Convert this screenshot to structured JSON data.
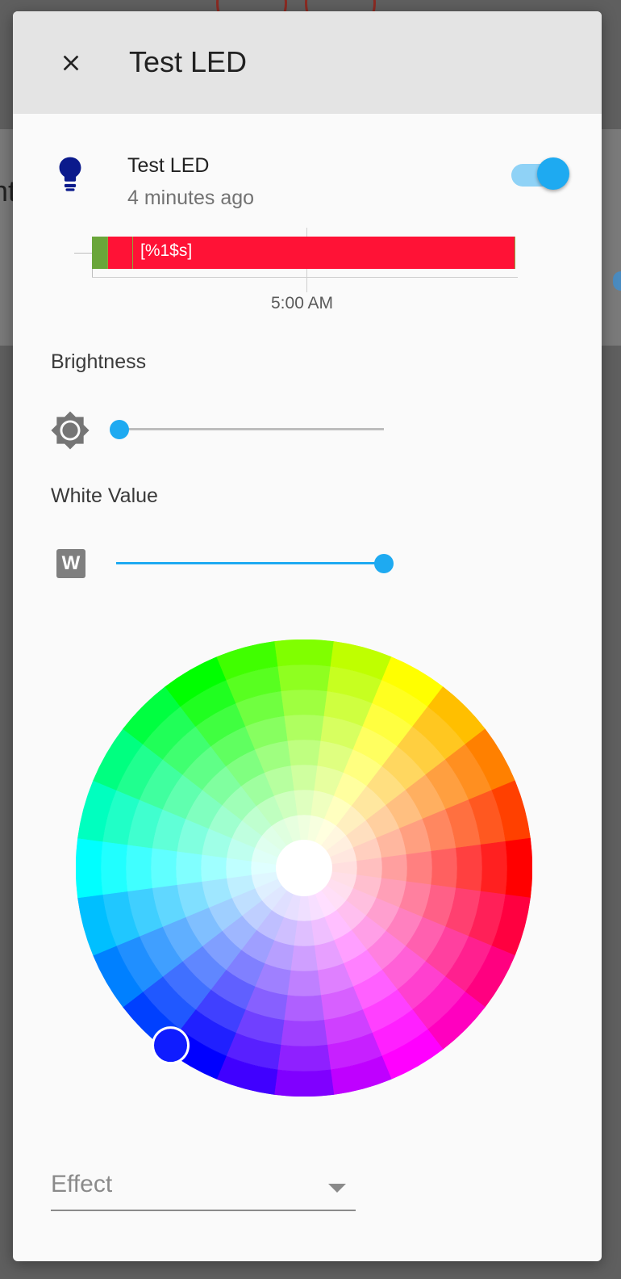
{
  "dialog": {
    "title": "Test LED"
  },
  "entity": {
    "name": "Test LED",
    "last_changed": "4 minutes ago",
    "state_on": true
  },
  "history": {
    "bar_label": "[%1$s]",
    "time_label": "5:00 AM",
    "colors": {
      "on": "#ff1236",
      "off": "#6aa63a"
    }
  },
  "brightness": {
    "label": "Brightness",
    "value_fraction": 0.0
  },
  "white_value": {
    "label": "White Value",
    "badge": "W",
    "value_fraction": 1.0
  },
  "color_picker": {
    "selected_hue": 233,
    "selected_saturation": 1.0,
    "selected_color": "#0f1cff"
  },
  "effect": {
    "label": "Effect"
  },
  "theme": {
    "accent": "#1eaaf1",
    "bulb_color": "#0b1a8c"
  }
}
